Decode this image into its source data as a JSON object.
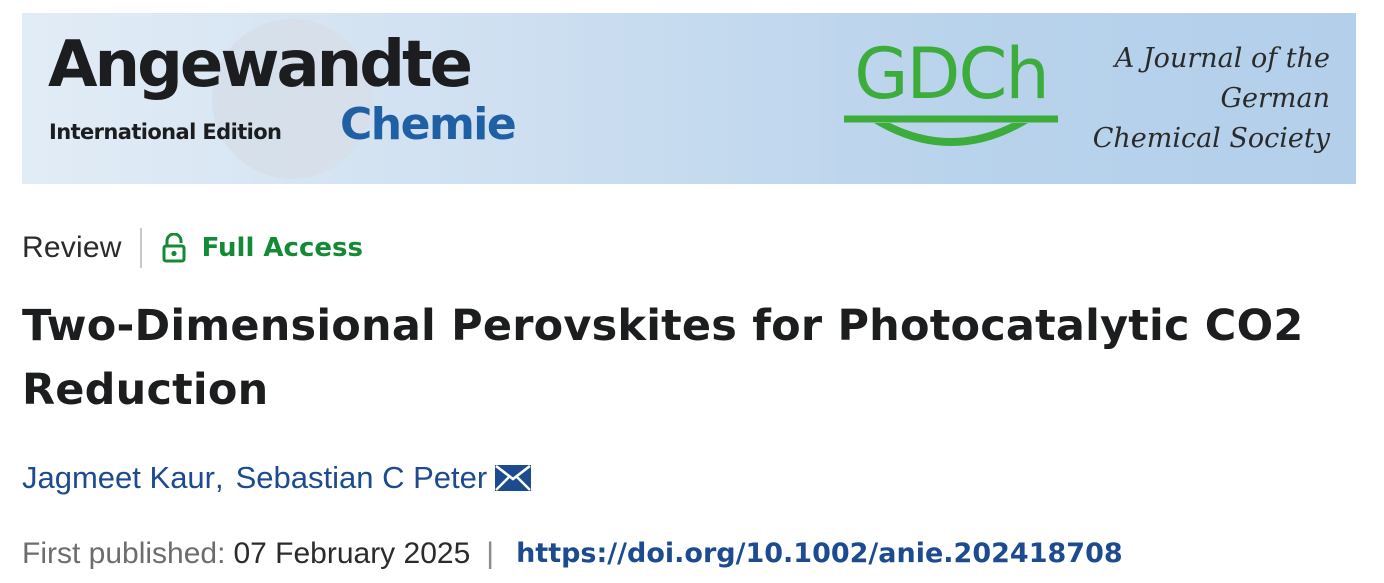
{
  "banner": {
    "journal_name_line1": "Angewandte",
    "journal_edition": "International Edition",
    "journal_name_line2": "Chemie",
    "society_logo": "GDCh",
    "society_tagline": [
      "A Journal of the",
      "German",
      "Chemical Society"
    ],
    "colors": {
      "banner_bg": "#cfe0f1",
      "chemie_blue": "#1f5fa4",
      "gdch_green": "#3cac3a"
    }
  },
  "meta": {
    "article_type": "Review",
    "access_label": "Full Access",
    "access_icon": "lock-open-icon",
    "access_color": "#138a36"
  },
  "article": {
    "title": "Two-Dimensional Perovskites for Photocatalytic CO2 Reduction",
    "authors": [
      "Jagmeet Kaur",
      "Sebastian C Peter"
    ],
    "author_separator": ",",
    "corresponding_icon": "envelope-icon",
    "first_published_label": "First published:",
    "first_published_date": "07 February 2025",
    "separator": "|",
    "doi": "https://doi.org/10.1002/anie.202418708",
    "link_color": "#1d4b8f"
  }
}
